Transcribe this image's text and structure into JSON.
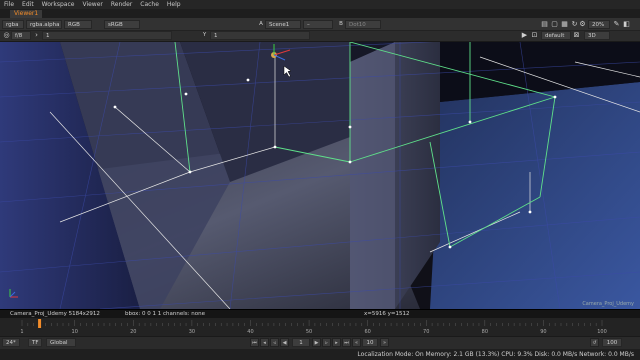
{
  "menu": [
    "File",
    "Edit",
    "Workspace",
    "Viewer",
    "Render",
    "Cache",
    "Help"
  ],
  "viewer_tab": "Viewer1",
  "toolbar": {
    "channels": "rgba",
    "alpha_channel": "rgba.alpha",
    "color_mode": "RGB",
    "colorspace": "sRGB",
    "input_a": "Scene1",
    "input_a_prefix": "A",
    "input_b": "Dot10",
    "input_b_prefix": "B",
    "zoom": "20%",
    "fstop": "f/8",
    "frame_field": "1",
    "y_label": "Y",
    "y_value": "1",
    "camera": "default",
    "view_mode": "3D"
  },
  "viewer_overlay": {
    "node_label": "Camera_Proj_Udemy"
  },
  "infobar": {
    "format": "Camera_Proj_Udemy 5184x2912",
    "bbox": "bbox: 0 0 1 1 channels: none",
    "coords": "x=5916 y=1512"
  },
  "timeline": {
    "ticks": [
      "1",
      "10",
      "20",
      "30",
      "40",
      "50",
      "60",
      "70",
      "80",
      "90",
      "100"
    ],
    "current_frame": 4,
    "end_frame": "100"
  },
  "transport": {
    "fps": "24*",
    "tf": "TF",
    "mode": "Global",
    "frame": "1",
    "increment": "10",
    "end": "100"
  },
  "status": "Localization Mode: On Memory: 2.1 GB (13.3%) CPU: 9.3% Disk: 0.0 MB/s Network: 0.0 MB/s",
  "colors": {
    "accent": "#f28c2a",
    "wireframe": "#5fe08a",
    "grid": "#3c4aa8"
  }
}
